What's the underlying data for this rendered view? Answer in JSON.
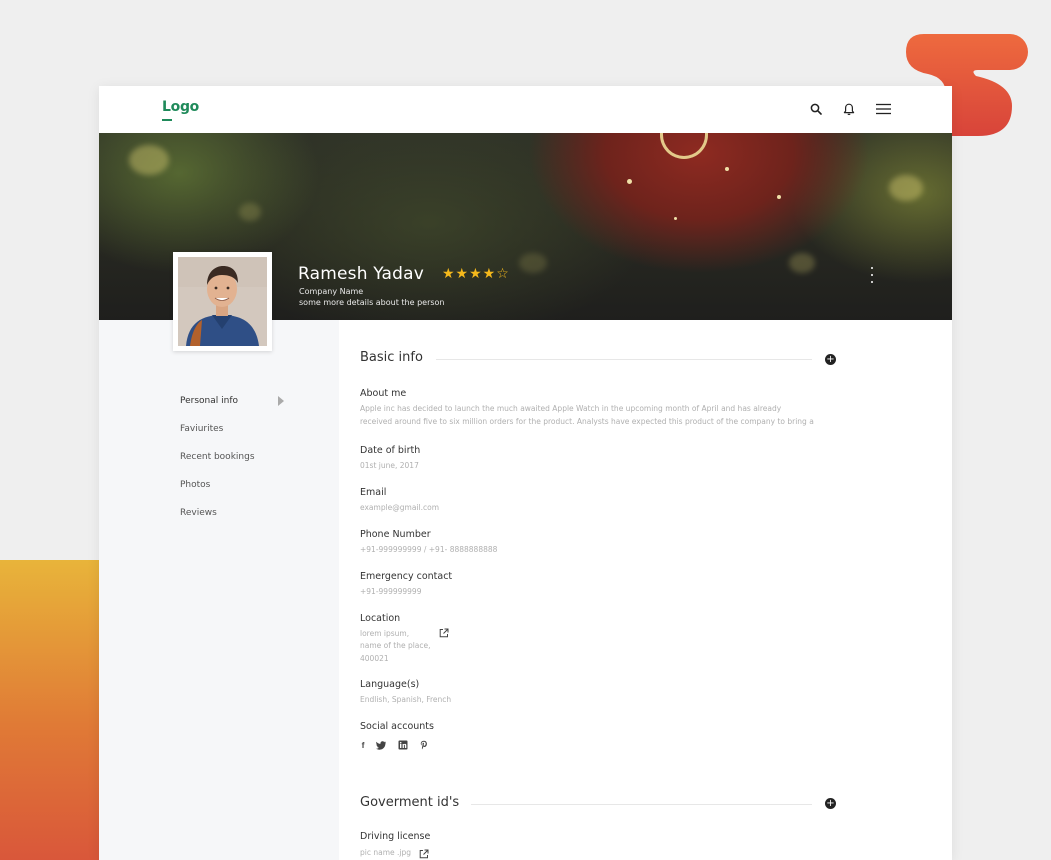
{
  "app": {
    "logo": "Logo"
  },
  "topbar": {
    "icons": [
      "search-icon",
      "bell-icon",
      "menu-icon"
    ]
  },
  "profile": {
    "name": "Ramesh Yadav",
    "rating": 4,
    "stars": "★★★★☆",
    "company": "Company Name",
    "details": "some more details about the person"
  },
  "sidebar": {
    "items": [
      {
        "label": "Personal info",
        "active": true
      },
      {
        "label": "Faviurites"
      },
      {
        "label": "Recent bookings"
      },
      {
        "label": "Photos"
      },
      {
        "label": "Reviews"
      }
    ]
  },
  "basic_info": {
    "title": "Basic info",
    "about_label": "About me",
    "about_line1": "Apple inc has decided to launch the much awaited Apple Watch in the upcoming month of April and has already",
    "about_line2": "received around five to six million orders for the product. Analysts have expected this product of the company to bring a",
    "dob_label": "Date of birth",
    "dob_value": "01st june, 2017",
    "email_label": "Email",
    "email_value": "example@gmail.com",
    "phone_label": "Phone Number",
    "phone_value": "+91-999999999 /  +91- 8888888888",
    "emergency_label": "Emergency contact",
    "emergency_value": "+91-999999999",
    "location_label": "Location",
    "location_line1": "lorem ipsum,",
    "location_line2": "name of the place,",
    "location_line3": "400021",
    "language_label": "Language(s)",
    "language_value": "Endlish, Spanish, French",
    "social_label": "Social accounts",
    "social_icons": [
      "facebook-icon",
      "twitter-icon",
      "linkedin-icon",
      "pinterest-icon"
    ]
  },
  "government_ids": {
    "title": "Goverment id's",
    "driving_label": "Driving license",
    "driving_value": "pic name .jpg"
  },
  "colors": {
    "brand": "#1f8a5a",
    "star": "#f5b91c",
    "accent_orange": "#e07a36",
    "accent_red": "#e0473a"
  }
}
